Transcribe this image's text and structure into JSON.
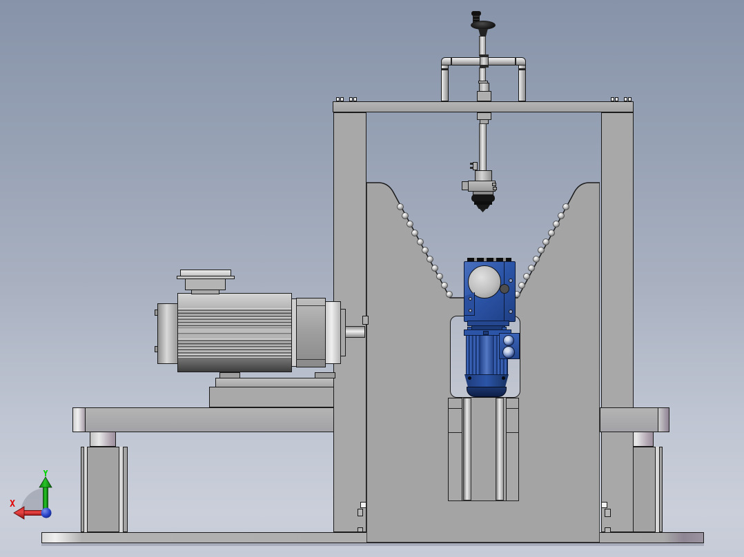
{
  "triad": {
    "x_label": "X",
    "y_label": "Y",
    "x_color": "#e10000",
    "y_color": "#00d300",
    "origin_color": "#2743c8"
  },
  "colors": {
    "background_top": "#8793a9",
    "background_bottom": "#c6cbd7",
    "machine_gray": "#a8a8a8",
    "outline": "#1a1a1a",
    "motor_blue": "#2c55a8",
    "motor_blue_dark": "#0f1f48",
    "handwheel_black": "#151515",
    "steel_highlight": "#f0f0f0"
  }
}
